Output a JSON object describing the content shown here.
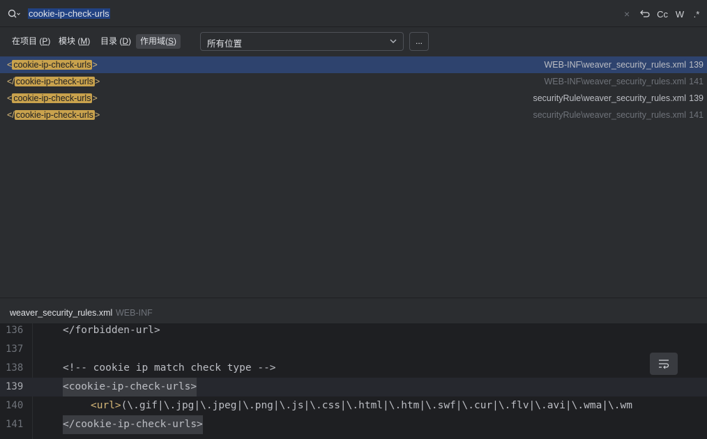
{
  "search": {
    "query": "cookie-ip-check-urls",
    "tools": {
      "clear": "×",
      "cc": "Cc",
      "w": "W",
      "regex": ".*"
    }
  },
  "scopes": [
    {
      "label": "在项目",
      "key": "P"
    },
    {
      "label": "模块",
      "key": "M"
    },
    {
      "label": "目录",
      "key": "D"
    },
    {
      "label": "作用域",
      "key": "S"
    }
  ],
  "location": {
    "value": "所有位置"
  },
  "more_label": "...",
  "results": [
    {
      "open": "<",
      "match": "cookie-ip-check-urls",
      "close": ">",
      "file": "WEB-INF\\weaver_security_rules.xml",
      "line": "139"
    },
    {
      "open": "</",
      "match": "cookie-ip-check-urls",
      "close": ">",
      "file": "WEB-INF\\weaver_security_rules.xml",
      "line": "141"
    },
    {
      "open": "<",
      "match": "cookie-ip-check-urls",
      "close": ">",
      "file": "securityRule\\weaver_security_rules.xml",
      "line": "139"
    },
    {
      "open": "</",
      "match": "cookie-ip-check-urls",
      "close": ">",
      "file": "securityRule\\weaver_security_rules.xml",
      "line": "141"
    }
  ],
  "preview": {
    "file_name": "weaver_security_rules.xml",
    "dir": "WEB-INF"
  },
  "code_lines": [
    {
      "n": "136",
      "text": "</forbidden-url>"
    },
    {
      "n": "137",
      "text": ""
    },
    {
      "n": "138",
      "text": "<!-- cookie ip match check type -->"
    },
    {
      "n": "139",
      "text": "<cookie-ip-check-urls>"
    },
    {
      "n": "140",
      "open": "<url>",
      "text": "(\\.gif|\\.jpg|\\.jpeg|\\.png|\\.js|\\.css|\\.html|\\.htm|\\.swf|\\.cur|\\.flv|\\.avi|\\.wma|\\.wm"
    },
    {
      "n": "141",
      "text": "</cookie-ip-check-urls>"
    }
  ]
}
